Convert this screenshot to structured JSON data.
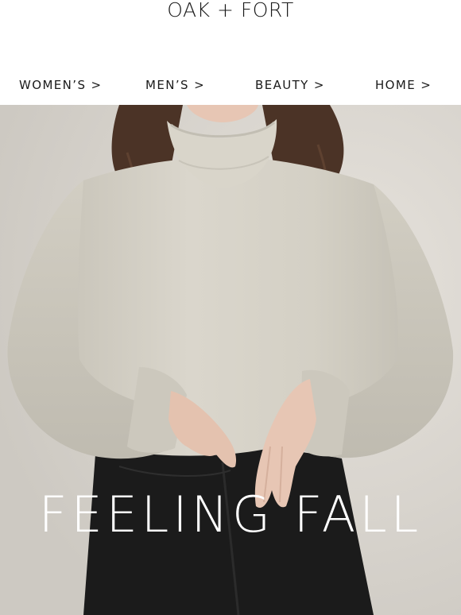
{
  "brand": {
    "logo_text": "OAK + FORT"
  },
  "nav": {
    "items": [
      {
        "label": "WOMEN’S >"
      },
      {
        "label": "MEN’S >"
      },
      {
        "label": "BEAUTY >"
      },
      {
        "label": "HOME >"
      }
    ]
  },
  "hero": {
    "title": "FEELING FALL",
    "colors": {
      "background": "#dcd8d1",
      "sweater": "#d6d2c7",
      "jeans": "#1b1b1b",
      "hair": "#4b3326",
      "skin": "#e7c6b4",
      "title": "#ffffff"
    }
  }
}
